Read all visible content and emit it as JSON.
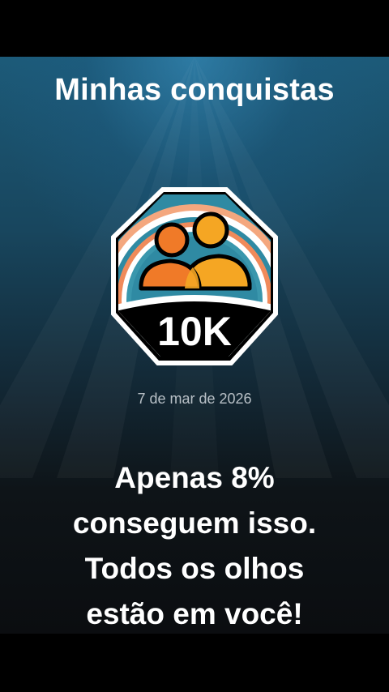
{
  "screen": {
    "title": "Minhas conquistas",
    "badge": {
      "label": "10K",
      "icon": "two-people-icon",
      "colors": {
        "outer_border": "#ffffff",
        "frame": "#000000",
        "sky": "#3a8ea6",
        "arc_orange": "#f08a5a",
        "person_left": "#f07a28",
        "person_right": "#f5a623",
        "label_band": "#000000"
      }
    },
    "date": "7 de mar de 2026",
    "message_lines": [
      "Apenas 8%",
      "conseguem isso.",
      "Todos os olhos",
      "estão em você!"
    ]
  }
}
